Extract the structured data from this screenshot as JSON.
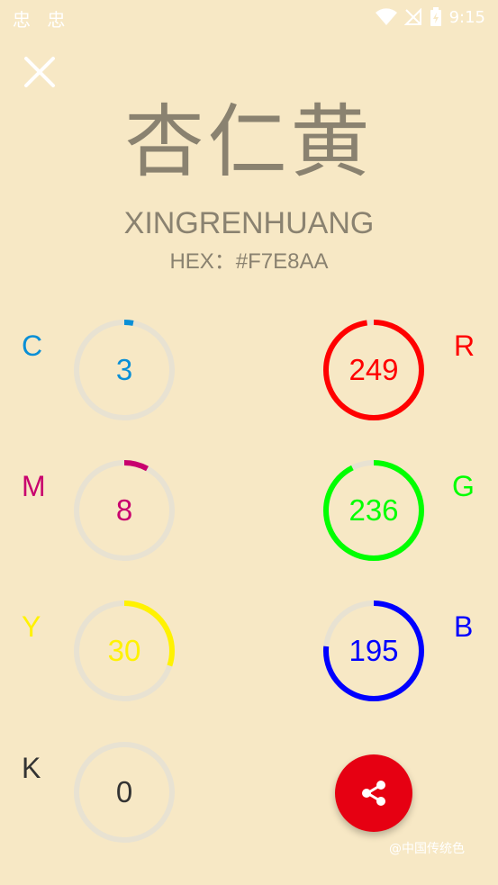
{
  "status_bar": {
    "left_icons": "忠 忠",
    "time": "9:15"
  },
  "color": {
    "name_cn": "杏仁黄",
    "pinyin": "XINGRENHUANG",
    "hex_label": "HEX：#F7E8AA"
  },
  "cmyk": [
    {
      "label": "C",
      "value": "3",
      "percent": 3,
      "color": "#0A8FD6"
    },
    {
      "label": "M",
      "value": "8",
      "percent": 8,
      "color": "#C8006E"
    },
    {
      "label": "Y",
      "value": "30",
      "percent": 30,
      "color": "#FFF200"
    },
    {
      "label": "K",
      "value": "0",
      "percent": 0,
      "color": "#333333"
    }
  ],
  "rgb": [
    {
      "label": "R",
      "value": "249",
      "max": 255,
      "color": "#FF0000"
    },
    {
      "label": "G",
      "value": "236",
      "max": 255,
      "color": "#00FF00"
    },
    {
      "label": "B",
      "value": "195",
      "max": 255,
      "color": "#0000FF"
    }
  ],
  "share": {
    "icon": "share-icon"
  },
  "watermark": "@中国传统色",
  "colors": {
    "background": "#F7E8C5",
    "text": "#8A8270",
    "track": "#E8E2D2",
    "share_button": "#E60012"
  }
}
